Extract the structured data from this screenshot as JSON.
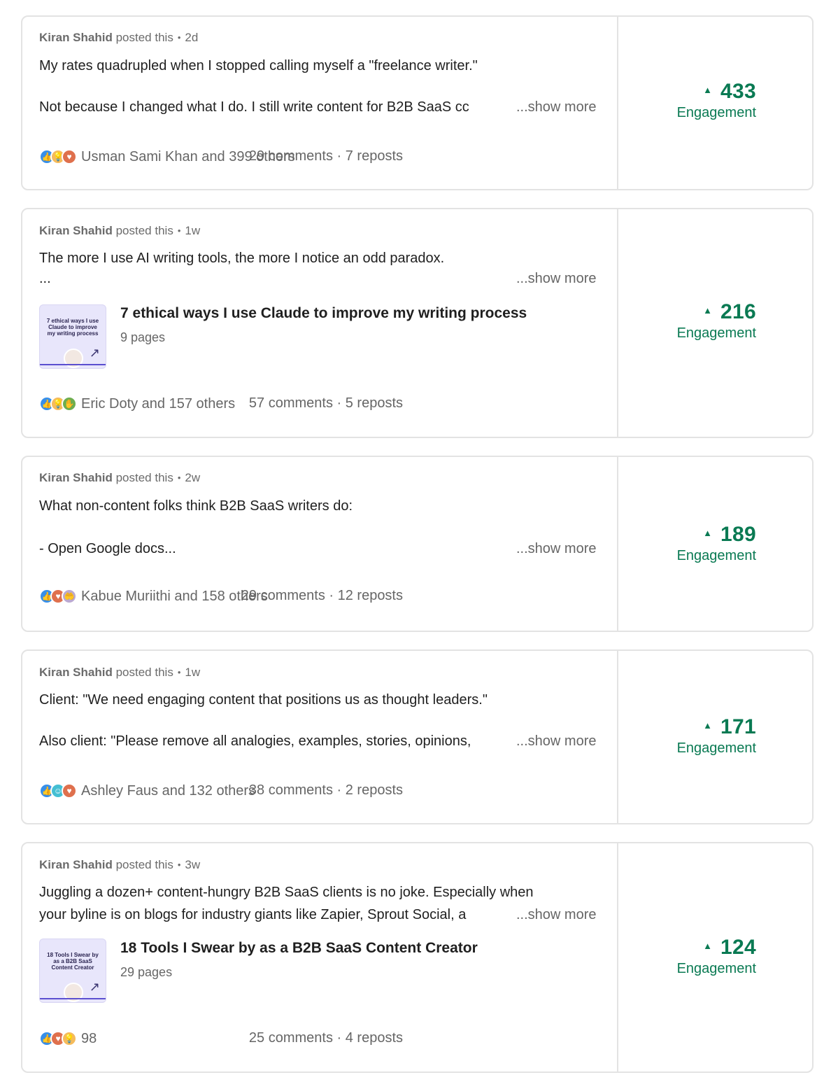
{
  "posts": [
    {
      "author": "Kiran Shahid",
      "action": "posted this",
      "age": "2d",
      "lines": [
        "My rates quadrupled when I stopped calling myself a \"freelance writer.\"",
        "Not because I changed what I do. I still write content for B2B SaaS cc"
      ],
      "show_more": "...show more",
      "reaction_icons": [
        "like-icon",
        "insight-icon",
        "love-icon"
      ],
      "reactions_text": "Usman Sami Khan and 399 others",
      "stats": "29 comments · 7 reposts",
      "engagement_value": "433",
      "engagement_label": "Engagement"
    },
    {
      "author": "Kiran Shahid",
      "action": "posted this",
      "age": "1w",
      "lines": [
        "The more I use AI writing tools, the more I notice an odd paradox.",
        "..."
      ],
      "show_more": "...show more",
      "document": {
        "thumb_text": "7 ethical ways I use Claude to improve my writing process",
        "title": "7 ethical ways I use Claude to improve my writing process",
        "pages": "9 pages"
      },
      "reaction_icons": [
        "like-icon",
        "insight-icon",
        "celebrate-icon"
      ],
      "reactions_text": "Eric Doty and 157 others",
      "stats": "57 comments · 5 reposts",
      "engagement_value": "216",
      "engagement_label": "Engagement"
    },
    {
      "author": "Kiran Shahid",
      "action": "posted this",
      "age": "2w",
      "lines": [
        "What non-content folks think B2B SaaS writers do:",
        "- Open Google docs..."
      ],
      "show_more": "...show more",
      "reaction_icons": [
        "like-icon",
        "love-icon",
        "support-icon"
      ],
      "reactions_text": "Kabue Muriithi and 158 others",
      "stats": "29 comments · 12 reposts",
      "engagement_value": "189",
      "engagement_label": "Engagement"
    },
    {
      "author": "Kiran Shahid",
      "action": "posted this",
      "age": "1w",
      "lines": [
        "Client: \"We need engaging content that positions us as thought leaders.\"",
        "Also client: \"Please remove all analogies, examples, stories, opinions,"
      ],
      "show_more": "...show more",
      "reaction_icons": [
        "like-icon",
        "funny-icon",
        "love-icon"
      ],
      "reactions_text": "Ashley Faus and 132 others",
      "stats": "38 comments · 2 reposts",
      "engagement_value": "171",
      "engagement_label": "Engagement"
    },
    {
      "author": "Kiran Shahid",
      "action": "posted this",
      "age": "3w",
      "lines": [
        "Juggling a dozen+ content-hungry B2B SaaS clients is no joke. Especially when",
        "your byline is on blogs for industry giants like Zapier, Sprout Social, a"
      ],
      "show_more": "...show more",
      "document": {
        "thumb_text": "18 Tools I Swear by as a B2B SaaS Content Creator",
        "title": "18 Tools I Swear by as a B2B SaaS Content Creator",
        "pages": "29 pages"
      },
      "reaction_icons": [
        "like-icon",
        "love-icon",
        "insight-icon"
      ],
      "reactions_text": "98",
      "stats": "25 comments · 4 reposts",
      "engagement_value": "124",
      "engagement_label": "Engagement"
    }
  ],
  "colors": {
    "engagement_green": "#0a7a53",
    "border": "#e3e3e3",
    "muted_text": "#666666",
    "like_blue": "#378fe9",
    "love_red": "#df704d",
    "insight_yellow": "#f5bb5c",
    "celebrate_green": "#6dae4f",
    "support_purple": "#bba9d1",
    "funny_teal": "#44bfd3",
    "doc_bg": "#e8e6fb"
  }
}
